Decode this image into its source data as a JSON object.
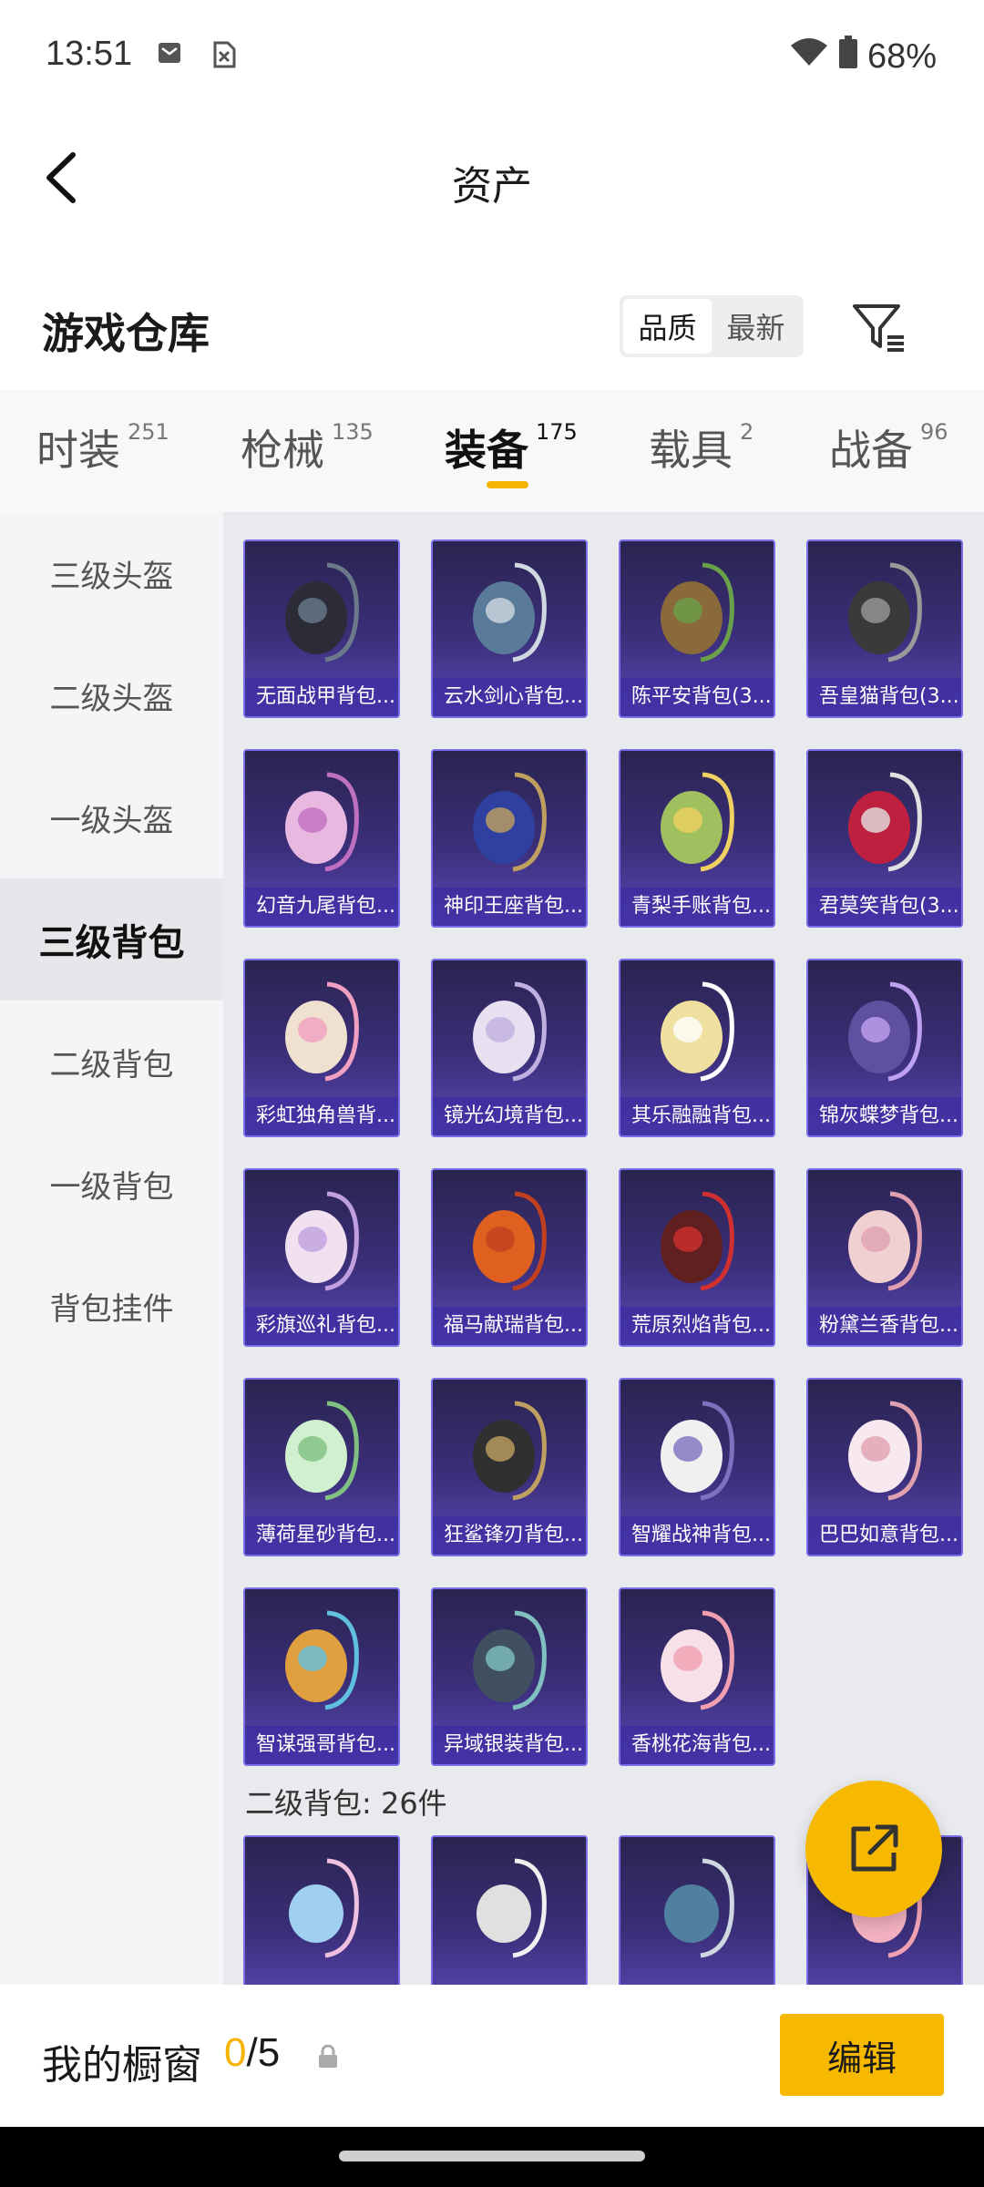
{
  "status_bar": {
    "time": "13:51",
    "battery": "68%",
    "icons": [
      "mail-icon",
      "sim-icon",
      "wifi-icon",
      "battery-icon"
    ]
  },
  "header": {
    "title": "资产",
    "back_icon": "chevron-left-icon"
  },
  "warehouse": {
    "title": "游戏仓库",
    "sort_options": [
      "品质",
      "最新"
    ],
    "selected_sort": "品质",
    "filter_icon": "filter-icon"
  },
  "category_tabs": [
    {
      "name": "时装",
      "count": "251"
    },
    {
      "name": "枪械",
      "count": "135"
    },
    {
      "name": "装备",
      "count": "175",
      "active": true
    },
    {
      "name": "载具",
      "count": "2"
    },
    {
      "name": "战备",
      "count": "96"
    }
  ],
  "sidebar": {
    "items": [
      {
        "label": "三级头盔"
      },
      {
        "label": "二级头盔"
      },
      {
        "label": "一级头盔"
      },
      {
        "label": "三级背包",
        "active": true
      },
      {
        "label": "二级背包"
      },
      {
        "label": "一级背包"
      },
      {
        "label": "背包挂件"
      }
    ]
  },
  "grid": {
    "items": [
      {
        "label": "无面战甲背包..."
      },
      {
        "label": "云水剑心背包..."
      },
      {
        "label": "陈平安背包(3..."
      },
      {
        "label": "吾皇猫背包(3..."
      },
      {
        "label": "幻音九尾背包..."
      },
      {
        "label": "神印王座背包..."
      },
      {
        "label": "青梨手账背包..."
      },
      {
        "label": "君莫笑背包(3..."
      },
      {
        "label": "彩虹独角兽背..."
      },
      {
        "label": "镜光幻境背包..."
      },
      {
        "label": "其乐融融背包..."
      },
      {
        "label": "锦灰蝶梦背包..."
      },
      {
        "label": "彩旗巡礼背包..."
      },
      {
        "label": "福马献瑞背包..."
      },
      {
        "label": "荒原烈焰背包..."
      },
      {
        "label": "粉黛兰香背包..."
      },
      {
        "label": "薄荷星砂背包..."
      },
      {
        "label": "狂鲨锋刃背包..."
      },
      {
        "label": "智耀战神背包..."
      },
      {
        "label": "巴巴如意背包..."
      },
      {
        "label": "智谋强哥背包..."
      },
      {
        "label": "异域银装背包..."
      },
      {
        "label": "香桃花海背包..."
      }
    ],
    "next_section_title": "二级背包: 26件"
  },
  "fab": {
    "icon": "share-icon"
  },
  "bottom_bar": {
    "showcase_label": "我的橱窗",
    "showcase_current": "0",
    "showcase_total": "/5",
    "lock_icon": "lock-icon",
    "edit_label": "编辑"
  },
  "colors": {
    "accent": "#f7b900",
    "card_border": "#7b6ee8",
    "card_bg": "#3b2f7a"
  }
}
